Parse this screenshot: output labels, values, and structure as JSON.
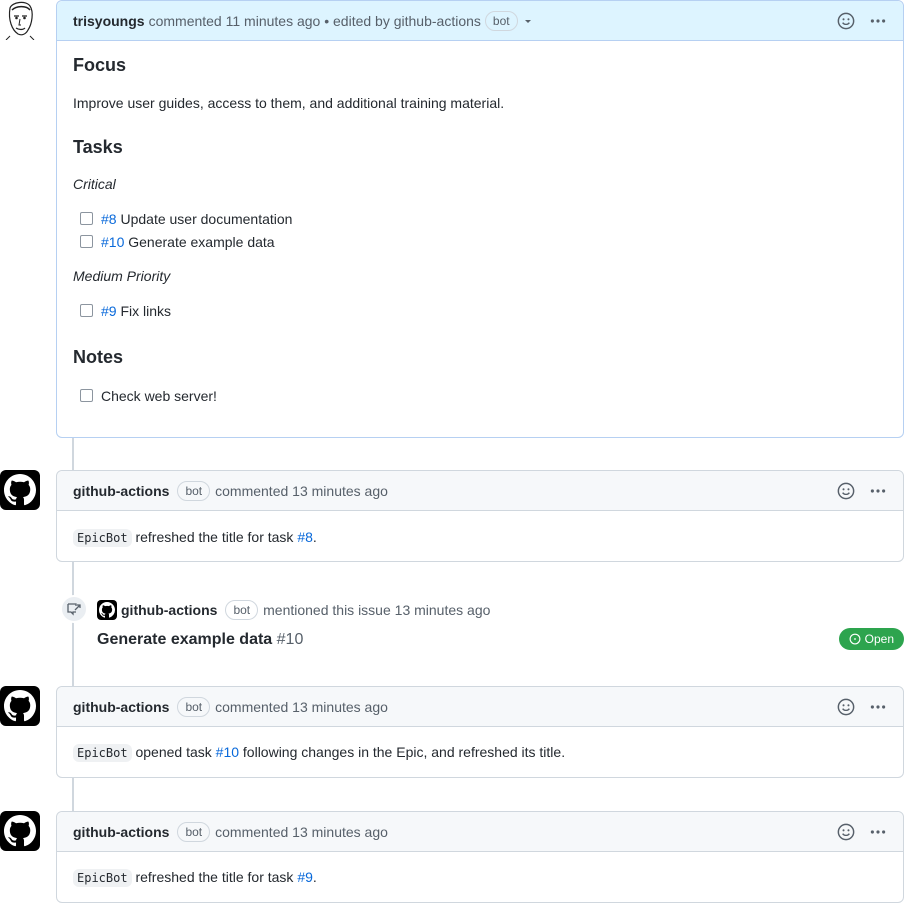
{
  "first_comment": {
    "author": "trisyoungs",
    "action": "commented",
    "time": "11 minutes ago",
    "edited_prefix": "• edited by",
    "editor": "github-actions",
    "editor_badge": "bot",
    "heading_focus": "Focus",
    "focus_text": "Improve user guides, access to them, and additional training material.",
    "heading_tasks": "Tasks",
    "critical_label": "Critical",
    "critical_tasks": [
      {
        "ref": "#8",
        "text": "Update user documentation"
      },
      {
        "ref": "#10",
        "text": "Generate example data"
      }
    ],
    "medium_label": "Medium Priority",
    "medium_tasks": [
      {
        "ref": "#9",
        "text": "Fix links"
      }
    ],
    "heading_notes": "Notes",
    "notes_tasks": [
      {
        "text": "Check web server!"
      }
    ]
  },
  "comments": [
    {
      "author": "github-actions",
      "badge": "bot",
      "action": "commented",
      "time": "13 minutes ago",
      "code": "EpicBot",
      "text_before": "refreshed the title for task",
      "ref": "#8",
      "text_after": "."
    },
    {
      "author": "github-actions",
      "badge": "bot",
      "action": "commented",
      "time": "13 minutes ago",
      "code": "EpicBot",
      "text_before": "opened task",
      "ref": "#10",
      "text_after": "following changes in the Epic, and refreshed its title."
    },
    {
      "author": "github-actions",
      "badge": "bot",
      "action": "commented",
      "time": "13 minutes ago",
      "code": "EpicBot",
      "text_before": "refreshed the title for task",
      "ref": "#9",
      "text_after": "."
    }
  ],
  "mention_event": {
    "author": "github-actions",
    "badge": "bot",
    "action": "mentioned this issue",
    "time": "13 minutes ago",
    "issue_title": "Generate example data",
    "issue_number": "#10",
    "status": "Open",
    "status_color": "#2da44e"
  },
  "icons": {
    "emoji": "smiley-icon",
    "more": "kebab-horizontal-icon",
    "dropdown": "triangle-down-icon",
    "cross_ref": "cross-reference-icon",
    "issue_open": "issue-opened-icon",
    "github_logo": "mark-github-icon"
  },
  "colors": {
    "link": "#0969da",
    "owner_header_bg": "#ddf4ff",
    "header_bg": "#f6f8fa"
  }
}
